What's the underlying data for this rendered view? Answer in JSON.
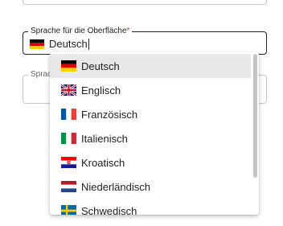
{
  "form": {
    "language_field": {
      "label": "Sprache für die Oberfläche",
      "required_marker": "*",
      "value": "Deutsch",
      "flag_icon": "germany-flag-icon"
    },
    "second_field": {
      "label_visible": "Sprac"
    }
  },
  "dropdown": {
    "options": [
      {
        "label": "Deutsch",
        "icon": "germany-flag-icon",
        "selected": true
      },
      {
        "label": "Englisch",
        "icon": "uk-flag-icon",
        "selected": false
      },
      {
        "label": "Französisch",
        "icon": "france-flag-icon",
        "selected": false
      },
      {
        "label": "Italienisch",
        "icon": "italy-flag-icon",
        "selected": false
      },
      {
        "label": "Kroatisch",
        "icon": "croatia-flag-icon",
        "selected": false
      },
      {
        "label": "Niederländisch",
        "icon": "netherlands-flag-icon",
        "selected": false
      },
      {
        "label": "Schwedisch",
        "icon": "sweden-flag-icon",
        "selected": false
      }
    ]
  },
  "colors": {
    "required": "#d32f2f",
    "selected_bg": "#e8e8e8",
    "border_active": "#212121"
  }
}
